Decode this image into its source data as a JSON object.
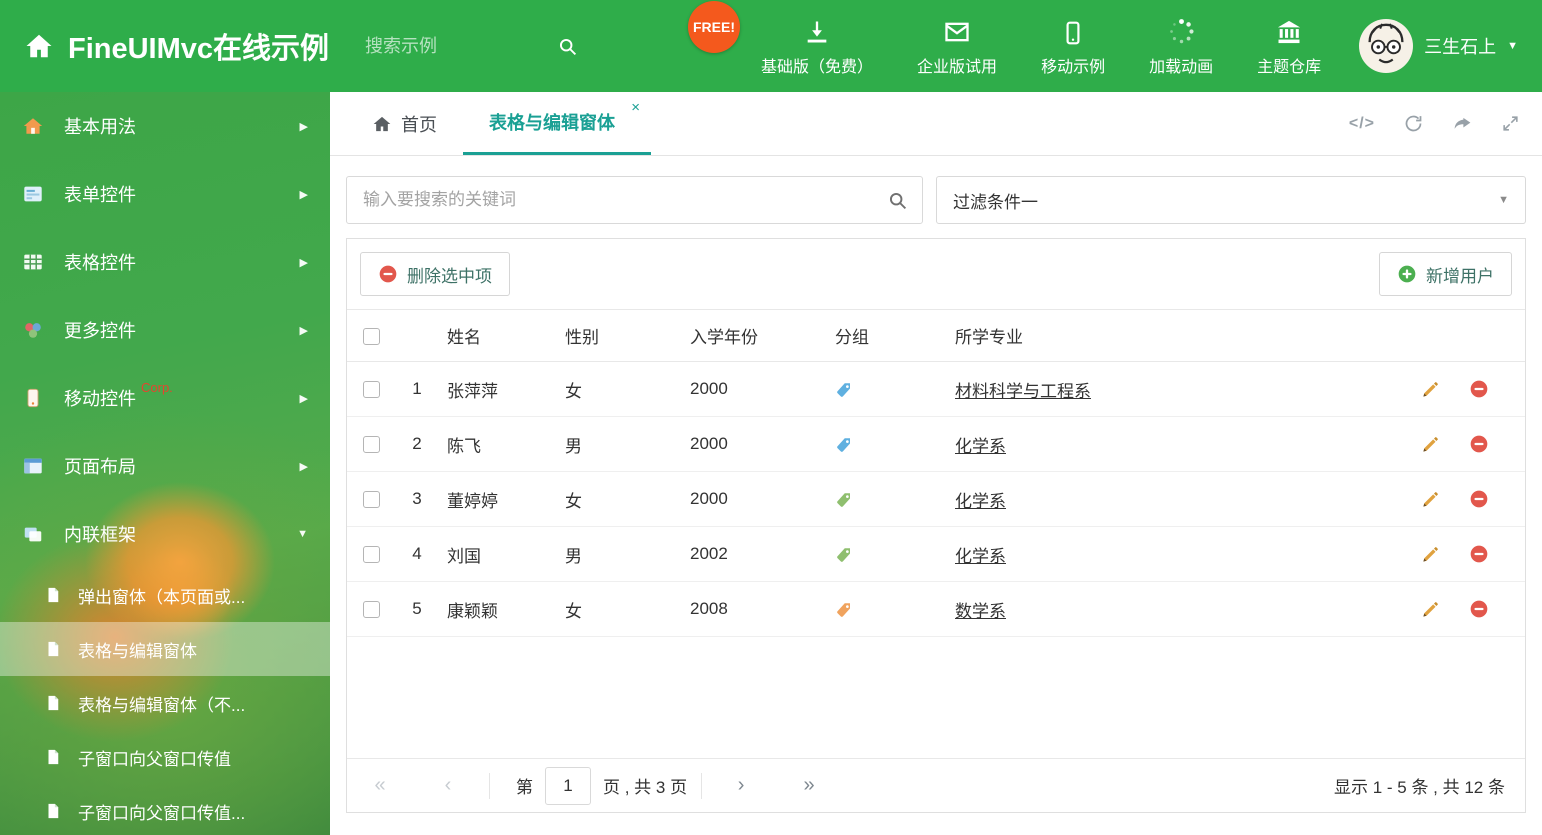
{
  "colors": {
    "header_green": "#2fad4a",
    "accent_teal": "#1aa094",
    "free_badge_orange": "#f4591d",
    "delete_red": "#e2574c",
    "add_green": "#4caf50",
    "pencil_gold": "#e0a23f"
  },
  "header": {
    "title": "FineUIMvc在线示例",
    "search_placeholder": "搜索示例",
    "free_badge": "FREE!",
    "nav": [
      {
        "label": "基础版（免费）",
        "icon": "download-icon"
      },
      {
        "label": "企业版试用",
        "icon": "mail-icon"
      },
      {
        "label": "移动示例",
        "icon": "mobile-icon"
      },
      {
        "label": "加载动画",
        "icon": "spinner-icon"
      },
      {
        "label": "主题仓库",
        "icon": "bank-icon"
      }
    ],
    "user_name": "三生石上"
  },
  "sidebar": {
    "items": [
      {
        "label": "基本用法",
        "icon": "home-icon"
      },
      {
        "label": "表单控件",
        "icon": "form-icon"
      },
      {
        "label": "表格控件",
        "icon": "table-icon"
      },
      {
        "label": "更多控件",
        "icon": "widgets-icon"
      },
      {
        "label": "移动控件",
        "badge": "Corp.",
        "icon": "mobile-icon"
      },
      {
        "label": "页面布局",
        "icon": "layout-icon"
      },
      {
        "label": "内联框架",
        "icon": "frame-icon"
      }
    ],
    "subitems": [
      {
        "label": "弹出窗体（本页面或..."
      },
      {
        "label": "表格与编辑窗体"
      },
      {
        "label": "表格与编辑窗体（不..."
      },
      {
        "label": "子窗口向父窗口传值"
      },
      {
        "label": "子窗口向父窗口传值..."
      }
    ]
  },
  "tabs": {
    "home": "首页",
    "active": "表格与编辑窗体"
  },
  "filters": {
    "search_placeholder": "输入要搜索的关键词",
    "filter_selected": "过滤条件一"
  },
  "toolbar": {
    "delete_label": "删除选中项",
    "add_label": "新增用户"
  },
  "table": {
    "headers": {
      "name": "姓名",
      "gender": "性别",
      "year": "入学年份",
      "group": "分组",
      "major": "所学专业"
    },
    "rows": [
      {
        "num": "1",
        "name": "张萍萍",
        "gender": "女",
        "year": "2000",
        "tag_color": "#5fb0e0",
        "major": "材料科学与工程系"
      },
      {
        "num": "2",
        "name": "陈飞",
        "gender": "男",
        "year": "2000",
        "tag_color": "#5fb0e0",
        "major": "化学系"
      },
      {
        "num": "3",
        "name": "董婷婷",
        "gender": "女",
        "year": "2000",
        "tag_color": "#8fbf6f",
        "major": "化学系"
      },
      {
        "num": "4",
        "name": "刘国",
        "gender": "男",
        "year": "2002",
        "tag_color": "#8fbf6f",
        "major": "化学系"
      },
      {
        "num": "5",
        "name": "康颖颖",
        "gender": "女",
        "year": "2008",
        "tag_color": "#f0a35e",
        "major": "数学系"
      }
    ]
  },
  "pagination": {
    "first": "«",
    "prev": "‹",
    "page_prefix": "第",
    "page_value": "1",
    "page_suffix": "页 , 共 3 页",
    "next": "›",
    "last": "»",
    "summary": "显示 1 - 5 条 , 共 12 条"
  }
}
